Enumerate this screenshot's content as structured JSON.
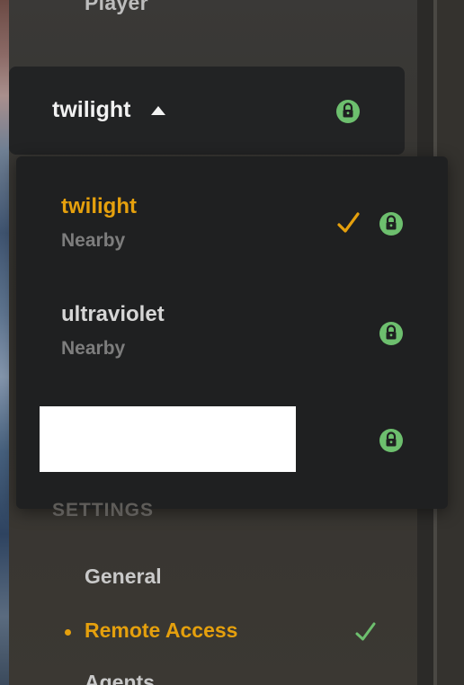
{
  "sidebar": {
    "partial_top_item": "Player",
    "settings_heading": "SETTINGS",
    "items": [
      {
        "label": "General",
        "active": false
      },
      {
        "label": "Remote Access",
        "active": true
      },
      {
        "label": "Agents",
        "active": false
      }
    ]
  },
  "server_selector": {
    "current": "twilight",
    "lock_icon": "lock-icon",
    "caret_icon": "caret-up-icon"
  },
  "server_list": [
    {
      "name": "twilight",
      "status": "Nearby",
      "selected": true,
      "secure": true
    },
    {
      "name": "ultraviolet",
      "status": "Nearby",
      "selected": false,
      "secure": true
    },
    {
      "name": "",
      "status": "",
      "selected": false,
      "secure": true,
      "redacted": true
    }
  ],
  "colors": {
    "accent": "#e5a00d",
    "secure_green": "#6dbf6e",
    "dropdown_bg": "#1f2021",
    "panel_bg": "#3a3937"
  }
}
